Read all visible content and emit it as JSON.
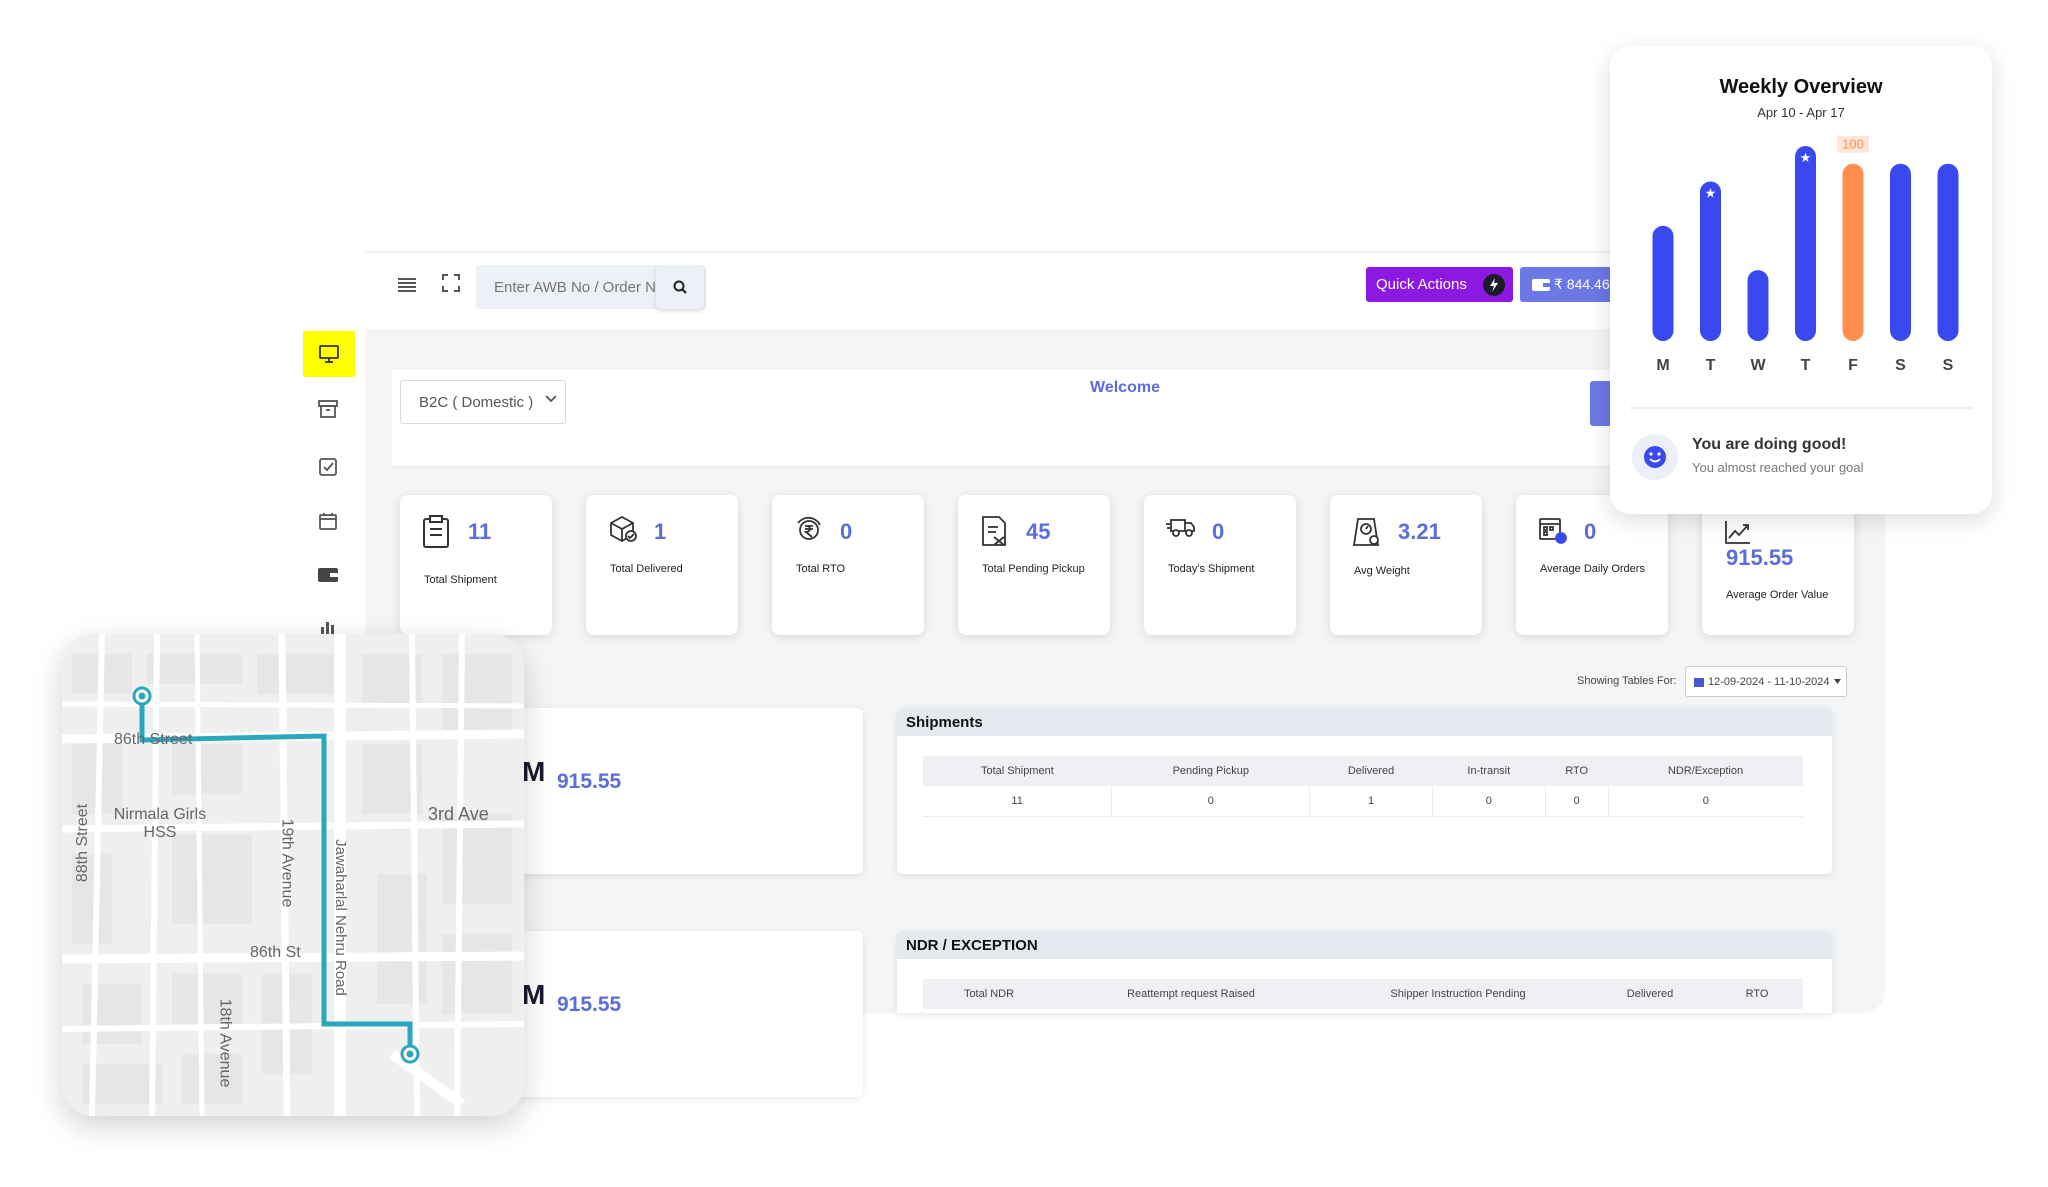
{
  "search": {
    "placeholder": "Enter AWB No / Order No"
  },
  "header": {
    "quick_actions": "Quick Actions",
    "wallet_balance": "₹ 844.46"
  },
  "panel": {
    "service_select": "B2C ( Domestic )",
    "welcome": "Welcome"
  },
  "sidebar": {
    "items": [
      {
        "icon": "monitor-icon",
        "active": true
      },
      {
        "icon": "archive-icon",
        "active": false
      },
      {
        "icon": "checkbox-icon",
        "active": false
      },
      {
        "icon": "calendar-icon",
        "active": false
      },
      {
        "icon": "wallet-icon",
        "active": false
      },
      {
        "icon": "bar-chart-icon",
        "active": false
      }
    ]
  },
  "stats": [
    {
      "value": "11",
      "label": "Total Shipment",
      "icon": "clipboard-icon"
    },
    {
      "value": "1",
      "label": "Total Delivered",
      "icon": "package-check-icon"
    },
    {
      "value": "0",
      "label": "Total RTO",
      "icon": "rupee-return-icon"
    },
    {
      "value": "45",
      "label": "Total Pending Pickup",
      "icon": "document-pending-icon"
    },
    {
      "value": "0",
      "label": "Today's Shipment",
      "icon": "truck-icon"
    },
    {
      "value": "3.21",
      "label": "Avg Weight",
      "icon": "scale-icon"
    },
    {
      "value": "0",
      "label": "Average Daily Orders",
      "icon": "calendar-orders-icon"
    },
    {
      "value": "915.55",
      "label": "Average Order Value",
      "icon": "trend-up-icon"
    }
  ],
  "filters": {
    "showing_label": "Showing Tables For:",
    "date_range": "12-09-2024 - 11-10-2024"
  },
  "left_cards": [
    {
      "value": "915.55"
    },
    {
      "value": "915.55"
    }
  ],
  "shipments_table": {
    "title": "Shipments",
    "headers": [
      "Total Shipment",
      "Pending Pickup",
      "Delivered",
      "In-transit",
      "RTO",
      "NDR/Exception"
    ],
    "rows": [
      [
        "11",
        "0",
        "1",
        "0",
        "0",
        "0"
      ]
    ]
  },
  "ndr_table": {
    "title": "NDR / EXCEPTION",
    "headers": [
      "Total NDR",
      "Reattempt request Raised",
      "Shipper Instruction Pending",
      "Delivered",
      "RTO"
    ]
  },
  "map": {
    "labels": [
      "86th Street",
      "Nirmala Girls HSS",
      "88th Street",
      "19th Avenue",
      "Jawaharlal Nehru Road",
      "3rd Ave",
      "86th St",
      "18th Avenue"
    ]
  },
  "weekly": {
    "title": "Weekly Overview",
    "date_range": "Apr 10 - Apr 17",
    "message": "You are doing good!",
    "sub_message": "You almost reached your goal",
    "chart_data": {
      "type": "bar",
      "categories": [
        "M",
        "T",
        "W",
        "T",
        "F",
        "S",
        "S"
      ],
      "values": [
        65,
        90,
        40,
        110,
        100,
        100,
        100
      ],
      "highlight_index": 4,
      "highlight_label": "100",
      "starred": [
        1,
        3
      ],
      "colors": {
        "default": "#3849f0",
        "highlight": "#ff8e4f"
      }
    }
  }
}
